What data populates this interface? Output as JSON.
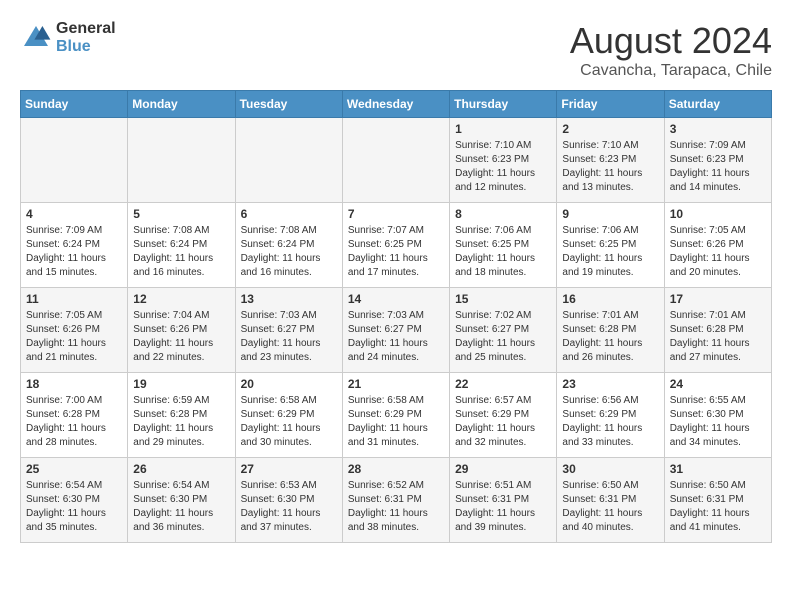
{
  "logo": {
    "line1": "General",
    "line2": "Blue"
  },
  "title": "August 2024",
  "subtitle": "Cavancha, Tarapaca, Chile",
  "days_of_week": [
    "Sunday",
    "Monday",
    "Tuesday",
    "Wednesday",
    "Thursday",
    "Friday",
    "Saturday"
  ],
  "weeks": [
    [
      {
        "day": "",
        "info": ""
      },
      {
        "day": "",
        "info": ""
      },
      {
        "day": "",
        "info": ""
      },
      {
        "day": "",
        "info": ""
      },
      {
        "day": "1",
        "info": "Sunrise: 7:10 AM\nSunset: 6:23 PM\nDaylight: 11 hours\nand 12 minutes."
      },
      {
        "day": "2",
        "info": "Sunrise: 7:10 AM\nSunset: 6:23 PM\nDaylight: 11 hours\nand 13 minutes."
      },
      {
        "day": "3",
        "info": "Sunrise: 7:09 AM\nSunset: 6:23 PM\nDaylight: 11 hours\nand 14 minutes."
      }
    ],
    [
      {
        "day": "4",
        "info": "Sunrise: 7:09 AM\nSunset: 6:24 PM\nDaylight: 11 hours\nand 15 minutes."
      },
      {
        "day": "5",
        "info": "Sunrise: 7:08 AM\nSunset: 6:24 PM\nDaylight: 11 hours\nand 16 minutes."
      },
      {
        "day": "6",
        "info": "Sunrise: 7:08 AM\nSunset: 6:24 PM\nDaylight: 11 hours\nand 16 minutes."
      },
      {
        "day": "7",
        "info": "Sunrise: 7:07 AM\nSunset: 6:25 PM\nDaylight: 11 hours\nand 17 minutes."
      },
      {
        "day": "8",
        "info": "Sunrise: 7:06 AM\nSunset: 6:25 PM\nDaylight: 11 hours\nand 18 minutes."
      },
      {
        "day": "9",
        "info": "Sunrise: 7:06 AM\nSunset: 6:25 PM\nDaylight: 11 hours\nand 19 minutes."
      },
      {
        "day": "10",
        "info": "Sunrise: 7:05 AM\nSunset: 6:26 PM\nDaylight: 11 hours\nand 20 minutes."
      }
    ],
    [
      {
        "day": "11",
        "info": "Sunrise: 7:05 AM\nSunset: 6:26 PM\nDaylight: 11 hours\nand 21 minutes."
      },
      {
        "day": "12",
        "info": "Sunrise: 7:04 AM\nSunset: 6:26 PM\nDaylight: 11 hours\nand 22 minutes."
      },
      {
        "day": "13",
        "info": "Sunrise: 7:03 AM\nSunset: 6:27 PM\nDaylight: 11 hours\nand 23 minutes."
      },
      {
        "day": "14",
        "info": "Sunrise: 7:03 AM\nSunset: 6:27 PM\nDaylight: 11 hours\nand 24 minutes."
      },
      {
        "day": "15",
        "info": "Sunrise: 7:02 AM\nSunset: 6:27 PM\nDaylight: 11 hours\nand 25 minutes."
      },
      {
        "day": "16",
        "info": "Sunrise: 7:01 AM\nSunset: 6:28 PM\nDaylight: 11 hours\nand 26 minutes."
      },
      {
        "day": "17",
        "info": "Sunrise: 7:01 AM\nSunset: 6:28 PM\nDaylight: 11 hours\nand 27 minutes."
      }
    ],
    [
      {
        "day": "18",
        "info": "Sunrise: 7:00 AM\nSunset: 6:28 PM\nDaylight: 11 hours\nand 28 minutes."
      },
      {
        "day": "19",
        "info": "Sunrise: 6:59 AM\nSunset: 6:28 PM\nDaylight: 11 hours\nand 29 minutes."
      },
      {
        "day": "20",
        "info": "Sunrise: 6:58 AM\nSunset: 6:29 PM\nDaylight: 11 hours\nand 30 minutes."
      },
      {
        "day": "21",
        "info": "Sunrise: 6:58 AM\nSunset: 6:29 PM\nDaylight: 11 hours\nand 31 minutes."
      },
      {
        "day": "22",
        "info": "Sunrise: 6:57 AM\nSunset: 6:29 PM\nDaylight: 11 hours\nand 32 minutes."
      },
      {
        "day": "23",
        "info": "Sunrise: 6:56 AM\nSunset: 6:29 PM\nDaylight: 11 hours\nand 33 minutes."
      },
      {
        "day": "24",
        "info": "Sunrise: 6:55 AM\nSunset: 6:30 PM\nDaylight: 11 hours\nand 34 minutes."
      }
    ],
    [
      {
        "day": "25",
        "info": "Sunrise: 6:54 AM\nSunset: 6:30 PM\nDaylight: 11 hours\nand 35 minutes."
      },
      {
        "day": "26",
        "info": "Sunrise: 6:54 AM\nSunset: 6:30 PM\nDaylight: 11 hours\nand 36 minutes."
      },
      {
        "day": "27",
        "info": "Sunrise: 6:53 AM\nSunset: 6:30 PM\nDaylight: 11 hours\nand 37 minutes."
      },
      {
        "day": "28",
        "info": "Sunrise: 6:52 AM\nSunset: 6:31 PM\nDaylight: 11 hours\nand 38 minutes."
      },
      {
        "day": "29",
        "info": "Sunrise: 6:51 AM\nSunset: 6:31 PM\nDaylight: 11 hours\nand 39 minutes."
      },
      {
        "day": "30",
        "info": "Sunrise: 6:50 AM\nSunset: 6:31 PM\nDaylight: 11 hours\nand 40 minutes."
      },
      {
        "day": "31",
        "info": "Sunrise: 6:50 AM\nSunset: 6:31 PM\nDaylight: 11 hours\nand 41 minutes."
      }
    ]
  ]
}
